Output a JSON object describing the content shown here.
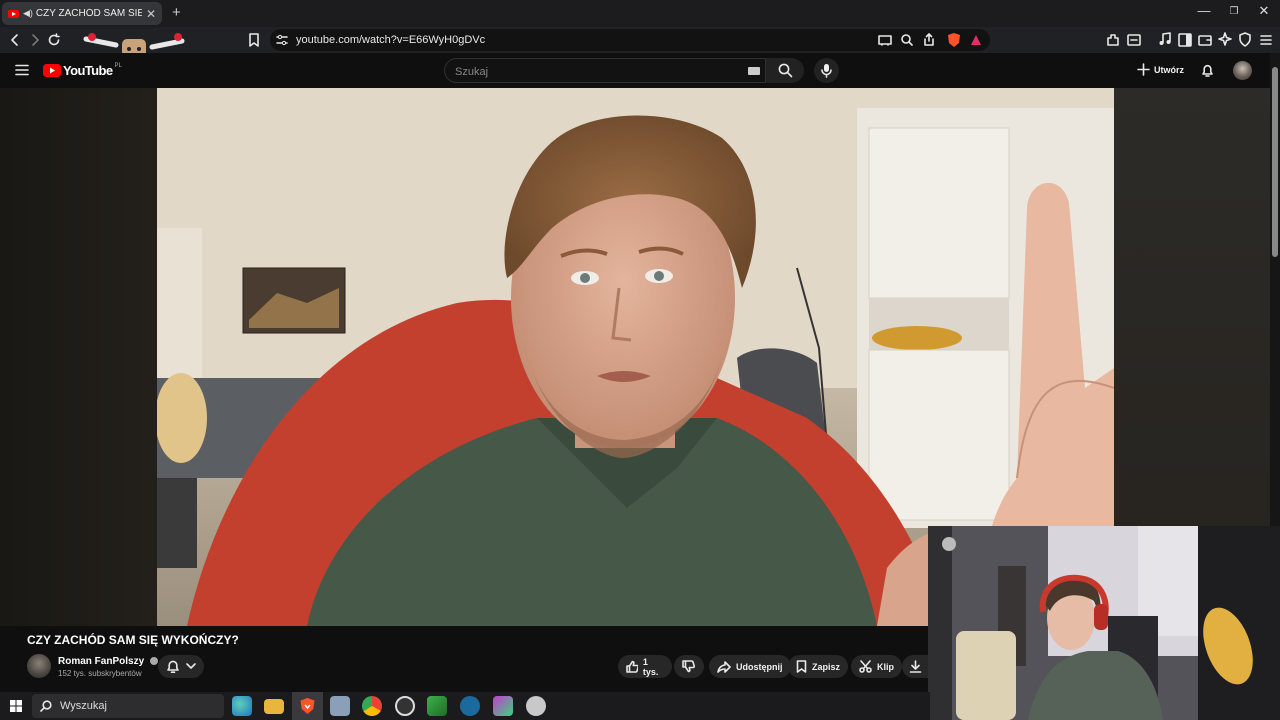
{
  "browser": {
    "tab_title": "CZY ZACHÓD SAM SIĘ WYKOŃ",
    "url": "youtube.com/watch?v=E66WyH0gDVc"
  },
  "youtube": {
    "logo_text": "YouTube",
    "region": "PL",
    "search_placeholder": "Szukaj",
    "create_label": "Utwórz"
  },
  "video": {
    "title": "CZY ZACHÓD SAM SIĘ WYKOŃCZY?",
    "channel": "Roman FanPolszy",
    "subscribers": "152 tys. subskrybentów",
    "likes": "1 tys.",
    "share_label": "Udostępnij",
    "save_label": "Zapisz",
    "clip_label": "Klip"
  },
  "taskbar": {
    "search_placeholder": "Wyszukaj"
  },
  "colors": {
    "youtube_red": "#ff0000",
    "brave_orange": "#fb542b",
    "background": "#0f0f0f"
  }
}
